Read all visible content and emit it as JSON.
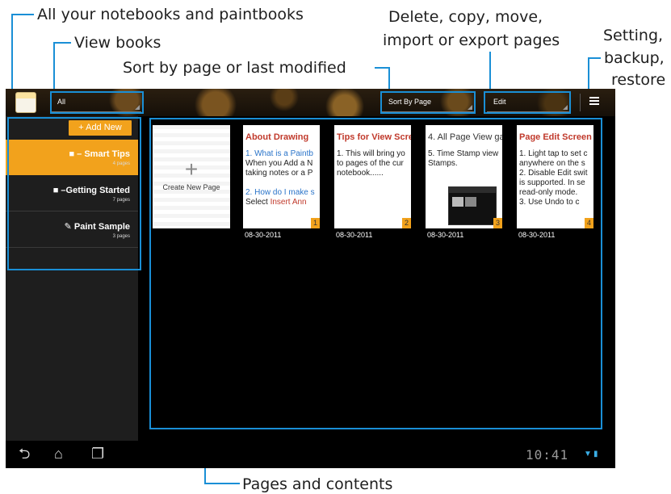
{
  "callouts": {
    "notebooks": "All your notebooks and paintbooks",
    "view_books": "View books",
    "sort": "Sort by page or last modified",
    "edit_line1": "Delete, copy, move,",
    "edit_line2": "import or export pages",
    "settings_line1": "Setting,",
    "settings_line2": "backup,",
    "settings_line3": "restore",
    "pages": "Pages and contents"
  },
  "topbar": {
    "view_filter": "All",
    "sort_option": "Sort By Page",
    "edit_menu": "Edit"
  },
  "sidebar": {
    "add_new": "+ Add New",
    "books": [
      {
        "title": "■ – Smart Tips",
        "count": "4 pages"
      },
      {
        "title": "■ –Getting Started",
        "count": "7 pages"
      },
      {
        "title": "✎ Paint Sample",
        "count": "3 pages"
      }
    ]
  },
  "create_page": {
    "label": "Create New Page",
    "plus": "+"
  },
  "pages": [
    {
      "title": "About Drawing",
      "lines": [
        "1. What is a Paintb",
        "When you Add a N",
        "taking notes or a P",
        "",
        "2. How do I make s",
        "Select Insert Ann"
      ],
      "num": "1",
      "date": "08-30-2011"
    },
    {
      "title": "Tips for View Scre",
      "lines": [
        "1. This will bring yo",
        "to pages of the cur",
        "notebook......"
      ],
      "num": "2",
      "date": "08-30-2011"
    },
    {
      "title": "4. All Page View ga",
      "lines": [
        "5. Time Stamp view",
        "Stamps."
      ],
      "num": "3",
      "date": "08-30-2011"
    },
    {
      "title": "Page Edit Screen",
      "lines": [
        "1. Light tap to set c",
        "anywhere on the s",
        "2. Disable Edit swit",
        "is supported. In se",
        "read-only mode.",
        "3. Use Undo to c"
      ],
      "num": "4",
      "date": "08-30-2011"
    }
  ],
  "navbar": {
    "back_icon": "back-arrow",
    "home_icon": "home",
    "recent_icon": "recent-apps",
    "clock": "10:41"
  },
  "colors": {
    "accent": "#f2a21c",
    "callout": "#1a8fd6",
    "page_title": "#c0392b"
  }
}
